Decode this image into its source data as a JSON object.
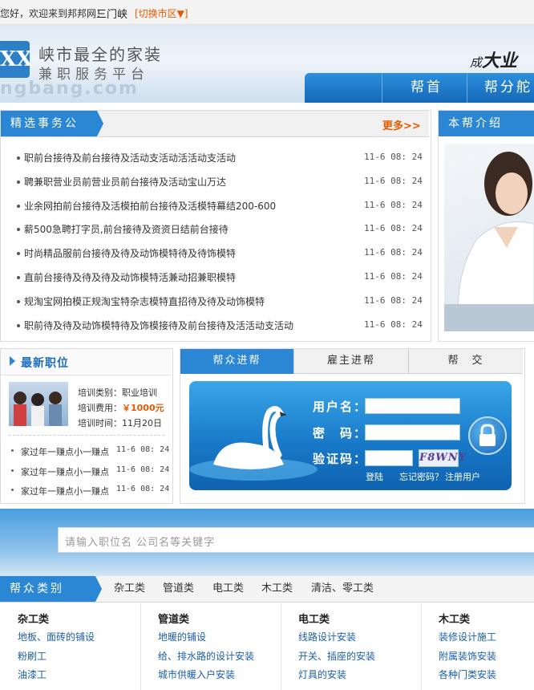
{
  "topbar": {
    "greeting": "您好，欢迎来到邦邦网！",
    "city": "三门峡",
    "switch_city": "[切换市区▼]"
  },
  "header": {
    "logo_text": "XX",
    "slogan_line1": "峡市最全的家装",
    "slogan_line2": "兼职服务平台",
    "domain_fragment": "ngbang.com",
    "motto_prefix": "成",
    "motto_big": "大业",
    "nav": [
      "帮首",
      "帮分舵"
    ]
  },
  "featured": {
    "title": "精选事务公",
    "more": "更多>>",
    "items": [
      {
        "title": "职前台接待及前台接待及活动支活动活活动支活动",
        "time": "11-6 08: 24"
      },
      {
        "title": "聘兼职营业员前营业员前台接待及活动宝山万达",
        "time": "11-6 08: 24"
      },
      {
        "title": "业余网拍前台接待及活模拍前台接待及活模特幕结200-600",
        "time": "11-6 08: 24"
      },
      {
        "title": "薪500急聘打字员,前台接待及资资日结前台接待",
        "time": "11-6 08: 24"
      },
      {
        "title": "时尚精品服前台接待及待及动饰模特待及待饰模特",
        "time": "11-6 08: 24"
      },
      {
        "title": "直前台接待及待及待及动饰模特活兼动招兼职模特",
        "time": "11-6 08: 24"
      },
      {
        "title": "规淘宝网拍模正规淘宝特杂志模特直招待及待及动饰模特",
        "time": "11-6 08: 24"
      },
      {
        "title": "职前待及待及动饰模特待及饰模接待及前台接待及活活动支活动",
        "time": "11-6 08: 24"
      }
    ]
  },
  "intro": {
    "title": "本帮介绍"
  },
  "latest_jobs": {
    "title": "最新职位",
    "training": {
      "type_label": "培训类别：",
      "type_value": "职业培训",
      "fee_label": "培训费用：",
      "fee_value": "￥1000元",
      "time_label": "培训时间：",
      "time_value": "11月20日"
    },
    "items": [
      {
        "title": "家过年一赚点小一赚点",
        "time": "11-6 08: 24"
      },
      {
        "title": "家过年一赚点小一赚点",
        "time": "11-6 08: 24"
      },
      {
        "title": "家过年一赚点小一赚点",
        "time": "11-6 08: 24"
      }
    ]
  },
  "login": {
    "tabs": [
      "帮众进帮",
      "雇主进帮",
      "帮　交"
    ],
    "username_label": "用户名：",
    "password_label": "密　码：",
    "captcha_label": "验证码：",
    "captcha_text": "F8WNY",
    "login_link": "登陆",
    "forgot_link": "忘记密码？",
    "register_link": "注册用户"
  },
  "search": {
    "placeholder": "请输入职位名 公司名等关键字"
  },
  "categories": {
    "title": "帮众类别",
    "tabs": [
      "杂工类",
      "管道类",
      "电工类",
      "木工类",
      "清洁、零工类"
    ],
    "columns": [
      {
        "title": "杂工类",
        "links": [
          "地板、面砖的铺设",
          "粉刷工",
          "油漆工"
        ]
      },
      {
        "title": "管道类",
        "links": [
          "地暖的铺设",
          "给、排水路的设计安装",
          "城市供暖入户安装"
        ]
      },
      {
        "title": "电工类",
        "links": [
          "线路设计安装",
          "开关、插座的安装",
          "灯具的安装"
        ]
      },
      {
        "title": "木工类",
        "links": [
          "装修设计施工",
          "附属装饰安装",
          "各种门类安装"
        ]
      }
    ]
  },
  "colors": {
    "accent": "#2b86d4",
    "orange": "#e85a00",
    "link": "#1a5ea8"
  }
}
